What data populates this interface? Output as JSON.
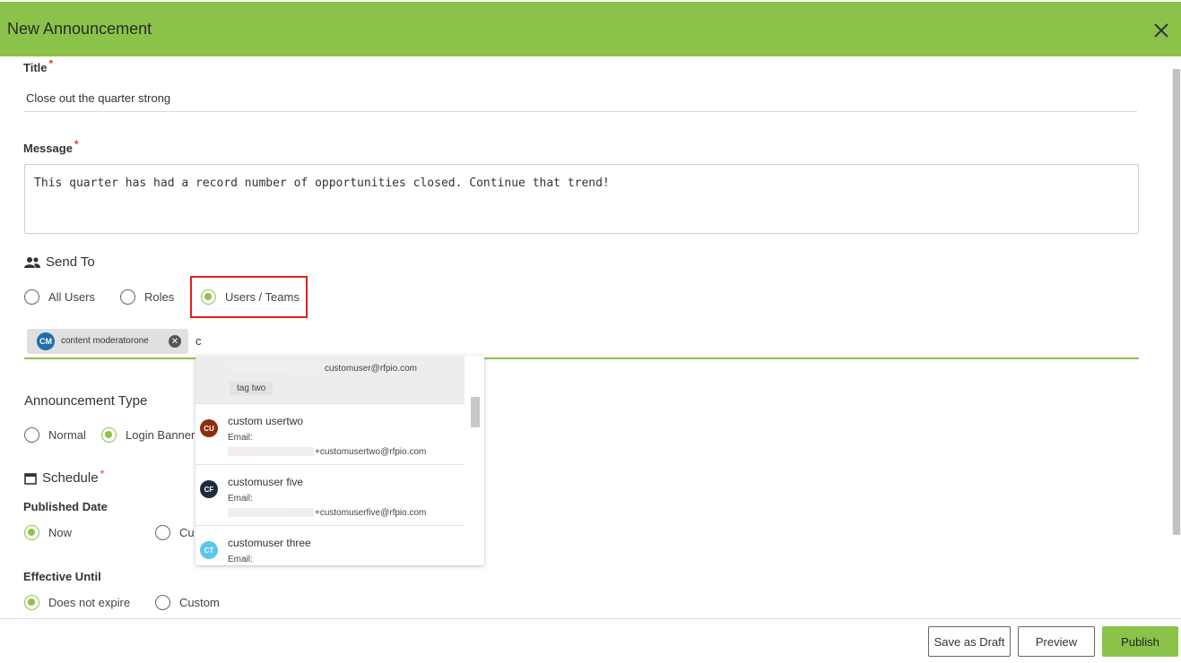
{
  "header": {
    "title": "New Announcement"
  },
  "form": {
    "title_label": "Title",
    "title_value": "Close out the quarter strong",
    "message_label": "Message",
    "message_value": "This quarter has had a record number of opportunities closed. Continue that trend!",
    "required_mark": "*"
  },
  "send_to": {
    "heading": "Send To",
    "options": [
      "All Users",
      "Roles",
      "Users / Teams"
    ],
    "selected": "Users / Teams",
    "chip": {
      "initials": "CM",
      "name": "content moderatorone"
    },
    "typed_text": "c"
  },
  "dropdown": {
    "items": [
      {
        "email_label": "Email:",
        "email": "customuser@rfpio.com",
        "tag": "tag two"
      },
      {
        "initials": "CU",
        "name": "custom usertwo",
        "email_label": "Email:",
        "email": "+customusertwo@rfpio.com",
        "color": "#8b2e0e"
      },
      {
        "initials": "CF",
        "name": "customuser five",
        "email_label": "Email:",
        "email": "+customuserfive@rfpio.com",
        "color": "#1d2b3a"
      },
      {
        "initials": "CT",
        "name": "customuser three",
        "email_label": "Email:",
        "color": "#5bc6ee"
      }
    ]
  },
  "announcement_type": {
    "heading": "Announcement Type",
    "options": [
      "Normal",
      "Login Banner"
    ],
    "selected": "Login Banner"
  },
  "schedule": {
    "heading": "Schedule",
    "published_label": "Published Date",
    "published_options": [
      "Now",
      "Cu"
    ],
    "published_selected": "Now",
    "effective_label": "Effective Until",
    "effective_options": [
      "Does not expire",
      "Custom"
    ],
    "effective_selected": "Does not expire"
  },
  "footer": {
    "save_draft": "Save as Draft",
    "preview": "Preview",
    "publish": "Publish"
  },
  "colors": {
    "accent": "#8bc34a",
    "highlight": "#e02020"
  }
}
